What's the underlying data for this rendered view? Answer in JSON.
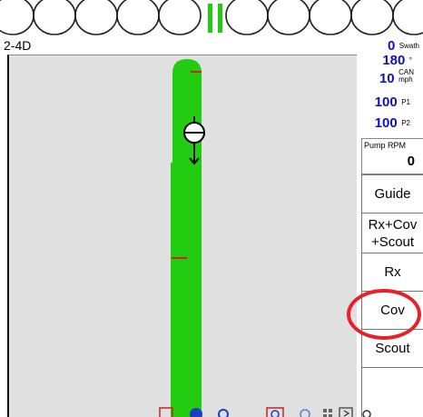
{
  "product": {
    "name": "2-4D"
  },
  "sections": {
    "count_left": 5,
    "count_right": 6,
    "active_indicator": "double-green-bar"
  },
  "status": {
    "swath": {
      "value": "0",
      "unit": "Swath"
    },
    "heading": {
      "value": "180",
      "unit": "°"
    },
    "speed": {
      "value": "10",
      "unit_top": "CAN",
      "unit_bottom": "mph"
    },
    "p1": {
      "value": "100",
      "unit": "P1"
    },
    "p2": {
      "value": "100",
      "unit": "P2"
    },
    "pump": {
      "label": "Pump RPM",
      "value": "0"
    }
  },
  "buttons": {
    "guide": "Guide",
    "rx_cov_line1": "Rx+Cov",
    "rx_cov_line2": "+Scout",
    "rx": "Rx",
    "cov": "Cov",
    "scout": "Scout"
  },
  "highlight": {
    "target": "Cov",
    "color": "#e8202a"
  },
  "map": {
    "background": "#e0e0e0",
    "coverage_color": "#22cc11",
    "marker_color": "#cc2222"
  },
  "bottom_toolbar_icons": [
    "gps-icon",
    "info-icon",
    "settings-icon",
    "zoom-icon",
    "search-icon",
    "grid-icon",
    "next-icon",
    "more-icon"
  ]
}
